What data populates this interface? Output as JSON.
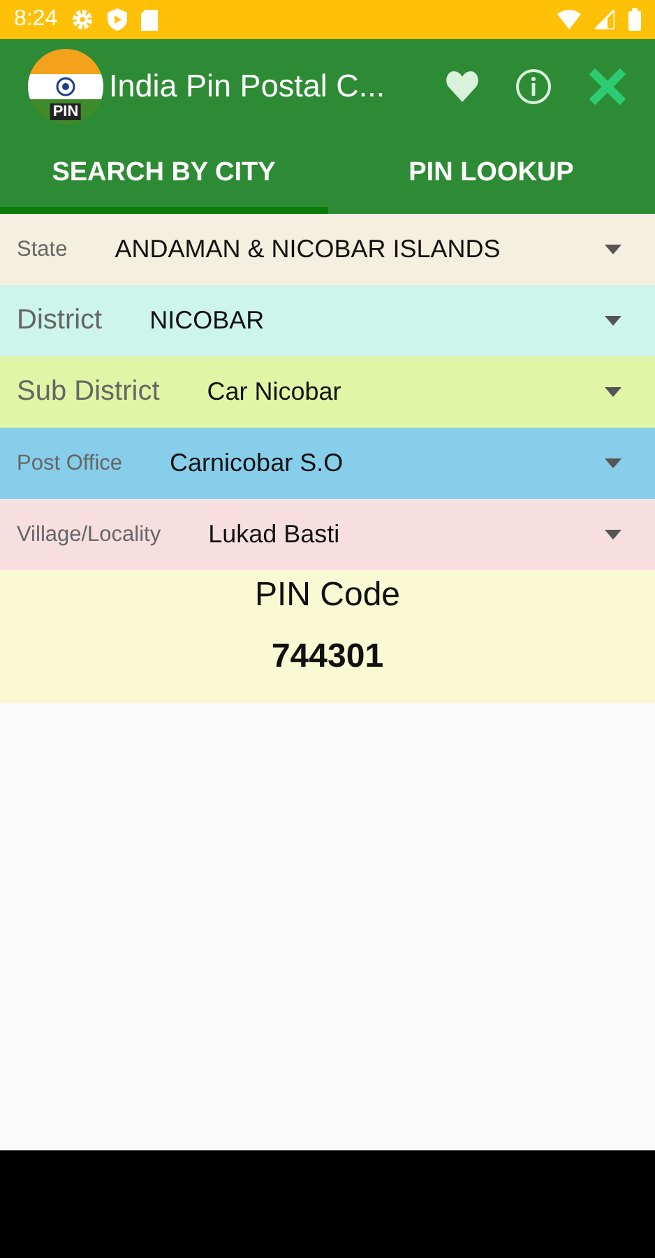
{
  "status_bar": {
    "time": "8:24"
  },
  "app_bar": {
    "logo_label": "PIN",
    "title": "India Pin Postal C..."
  },
  "tabs": [
    {
      "label": "SEARCH BY CITY",
      "selected": true
    },
    {
      "label": "PIN LOOKUP",
      "selected": false
    }
  ],
  "fields": [
    {
      "label": "State",
      "value": "ANDAMAN & NICOBAR ISLANDS",
      "color": "#f5efe0"
    },
    {
      "label": "District",
      "value": "NICOBAR",
      "color": "#cdf5ec"
    },
    {
      "label": "Sub District",
      "value": "Car Nicobar",
      "color": "#e0f5a6"
    },
    {
      "label": "Post Office",
      "value": "Carnicobar S.O",
      "color": "#87ceeb"
    },
    {
      "label": "Village/Locality",
      "value": "Lukad Basti",
      "color": "#f7dfe0"
    }
  ],
  "result": {
    "heading": "PIN Code",
    "pin": "744301"
  }
}
